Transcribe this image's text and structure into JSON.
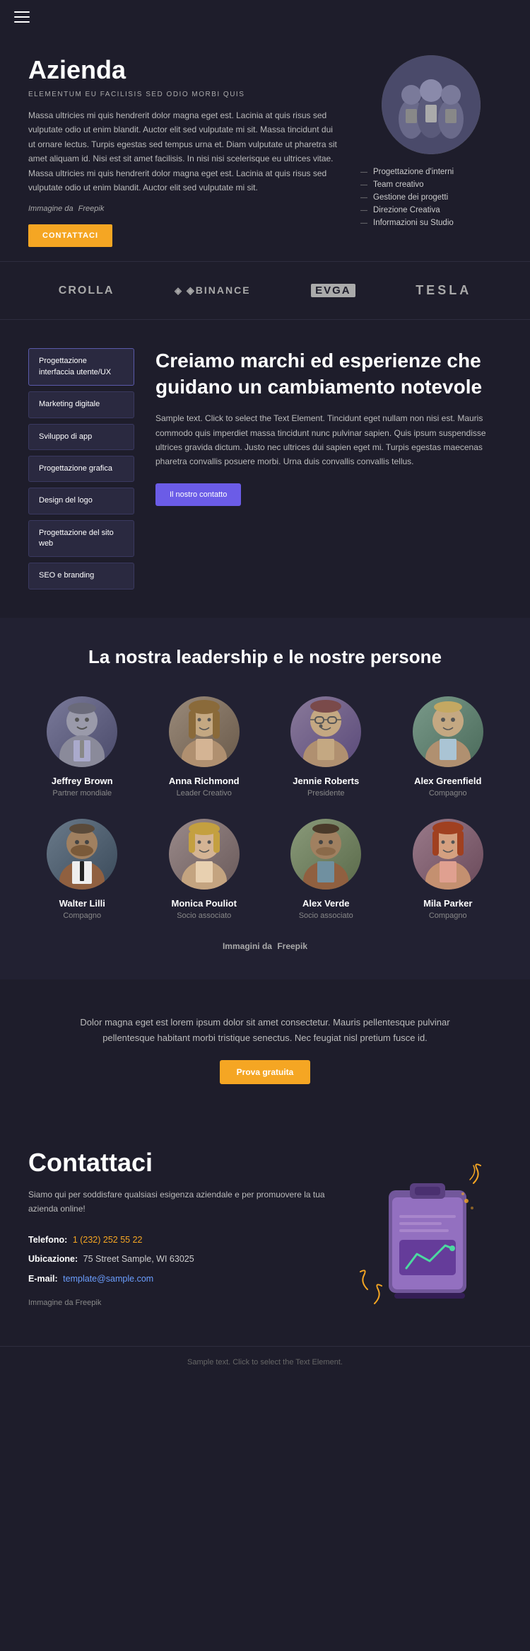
{
  "header": {
    "menu_icon": "hamburger-icon"
  },
  "hero": {
    "title": "Azienda",
    "subtitle": "ELEMENTUM EU FACILISIS SED ODIO MORBI QUIS",
    "body_text": "Massa ultricies mi quis hendrerit dolor magna eget est. Lacinia at quis risus sed vulputate odio ut enim blandit. Auctor elit sed vulputate mi sit. Massa tincidunt dui ut ornare lectus. Turpis egestas sed tempus urna et. Diam vulputate ut pharetra sit amet aliquam id. Nisi est sit amet facilisis. In nisi nisi scelerisque eu ultrices vitae. Massa ultricies mi quis hendrerit dolor magna eget est. Lacinia at quis risus sed vulputate odio ut enim blandit. Auctor elit sed vulputate mi sit.",
    "image_credit_label": "Immagine da",
    "image_credit_source": "Freepik",
    "contact_button": "CONTATTACI",
    "list_items": [
      "Progettazione d'interni",
      "Team creativo",
      "Gestione dei progetti",
      "Direzione Creativa",
      "Informazioni su Studio"
    ]
  },
  "brands": [
    {
      "name": "CROLLA",
      "type": "text"
    },
    {
      "name": "◈BINANCE",
      "type": "special"
    },
    {
      "name": "EVGA",
      "type": "special"
    },
    {
      "name": "TESLA",
      "type": "text"
    }
  ],
  "services": {
    "title": "Creiamo marchi ed esperienze che guidano un cambiamento notevole",
    "body_text": "Sample text. Click to select the Text Element. Tincidunt eget nullam non nisi est. Mauris commodo quis imperdiet massa tincidunt nunc pulvinar sapien. Quis ipsum suspendisse ultrices gravida dictum. Justo nec ultrices dui sapien eget mi. Turpis egestas maecenas pharetra convallis posuere morbi. Urna duis convallis convallis tellus.",
    "contact_button": "Il nostro contatto",
    "buttons": [
      "Progettazione interfaccia utente/UX",
      "Marketing digitale",
      "Sviluppo di app",
      "Progettazione grafica",
      "Design del logo",
      "Progettazione del sito web",
      "SEO e branding"
    ]
  },
  "leadership": {
    "title": "La nostra leadership e le nostre persone",
    "freepik_label": "Immagini da",
    "freepik_source": "Freepik",
    "team_row1": [
      {
        "name": "Jeffrey Brown",
        "role": "Partner mondiale"
      },
      {
        "name": "Anna Richmond",
        "role": "Leader Creativo"
      },
      {
        "name": "Jennie Roberts",
        "role": "Presidente"
      },
      {
        "name": "Alex Greenfield",
        "role": "Compagno"
      }
    ],
    "team_row2": [
      {
        "name": "Walter Lilli",
        "role": "Compagno"
      },
      {
        "name": "Monica Pouliot",
        "role": "Socio associato"
      },
      {
        "name": "Alex Verde",
        "role": "Socio associato"
      },
      {
        "name": "Mila Parker",
        "role": "Compagno"
      }
    ]
  },
  "cta": {
    "text": "Dolor magna eget est lorem ipsum dolor sit amet consectetur. Mauris pellentesque pulvinar pellentesque habitant morbi tristique senectus. Nec feugiat nisl pretium fusce id.",
    "button": "Prova gratuita"
  },
  "contact": {
    "title": "Contattaci",
    "description": "Siamo qui per soddisfare qualsiasi esigenza aziendale e per promuovere la tua azienda online!",
    "phone_label": "Telefono:",
    "phone_value": "1 (232) 252 55 22",
    "address_label": "Ubicazione:",
    "address_value": "75 Street Sample, WI 63025",
    "email_label": "E-mail:",
    "email_value": "template@sample.com",
    "image_credit_label": "Immagine da Freepik"
  },
  "footer": {
    "text": "Sample text. Click to select the Text Element."
  }
}
